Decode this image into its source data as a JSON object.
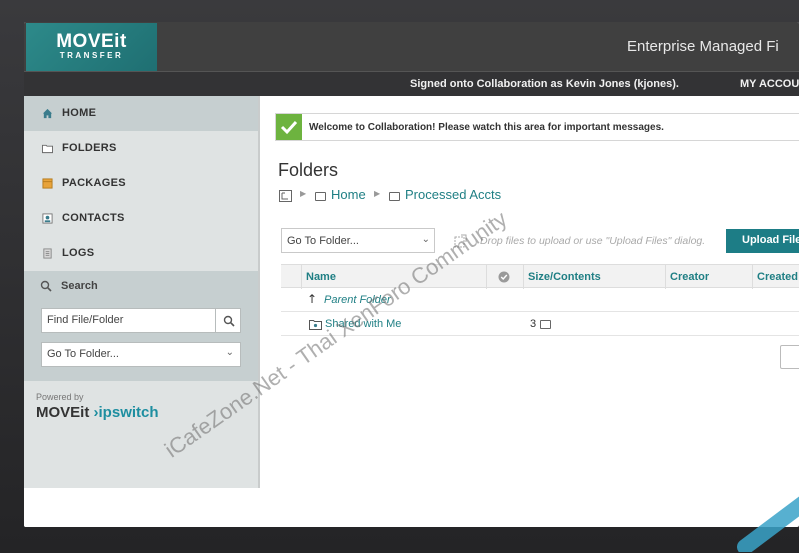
{
  "app": {
    "logo_line1": "MOVEit",
    "logo_line2": "TRANSFER",
    "title": "Enterprise Managed Fi"
  },
  "userbar": {
    "signed_in_text": "Signed onto Collaboration as Kevin Jones (kjones).",
    "my_account": "MY ACCOU"
  },
  "sidebar": {
    "items": [
      {
        "label": "HOME",
        "icon": "home-icon"
      },
      {
        "label": "FOLDERS",
        "icon": "folder-icon"
      },
      {
        "label": "PACKAGES",
        "icon": "package-icon"
      },
      {
        "label": "CONTACTS",
        "icon": "contacts-icon"
      },
      {
        "label": "LOGS",
        "icon": "logs-icon"
      }
    ],
    "search_label": "Search",
    "find_placeholder": "Find File/Folder",
    "goto_value": "Go To Folder...",
    "powered_by": "Powered by",
    "brand_moveit": "MOVEit",
    "brand_ipswitch": "ipswitch"
  },
  "message": {
    "text": "Welcome to Collaboration! Please watch this area for important messages."
  },
  "main": {
    "title": "Folders",
    "breadcrumb": [
      "Home",
      "Processed Accts"
    ],
    "goto_value": "Go To Folder...",
    "drop_hint": "Drop files to upload or use \"Upload Files\" dialog.",
    "upload_label": "Upload File"
  },
  "table": {
    "columns": [
      "Name",
      "Size/Contents",
      "Creator",
      "Created"
    ],
    "rows": [
      {
        "name": "Parent Folder",
        "size": ""
      },
      {
        "name": "Shared with Me",
        "size": "3"
      }
    ]
  },
  "watermark": {
    "line1": "iCafeZone.Net - Thai XenForo Community",
    "corner": "iCafeZone"
  },
  "colors": {
    "accent": "#1d7d86",
    "topbar": "#404040",
    "sidebar": "#dfe3e3",
    "success": "#6db33f"
  }
}
